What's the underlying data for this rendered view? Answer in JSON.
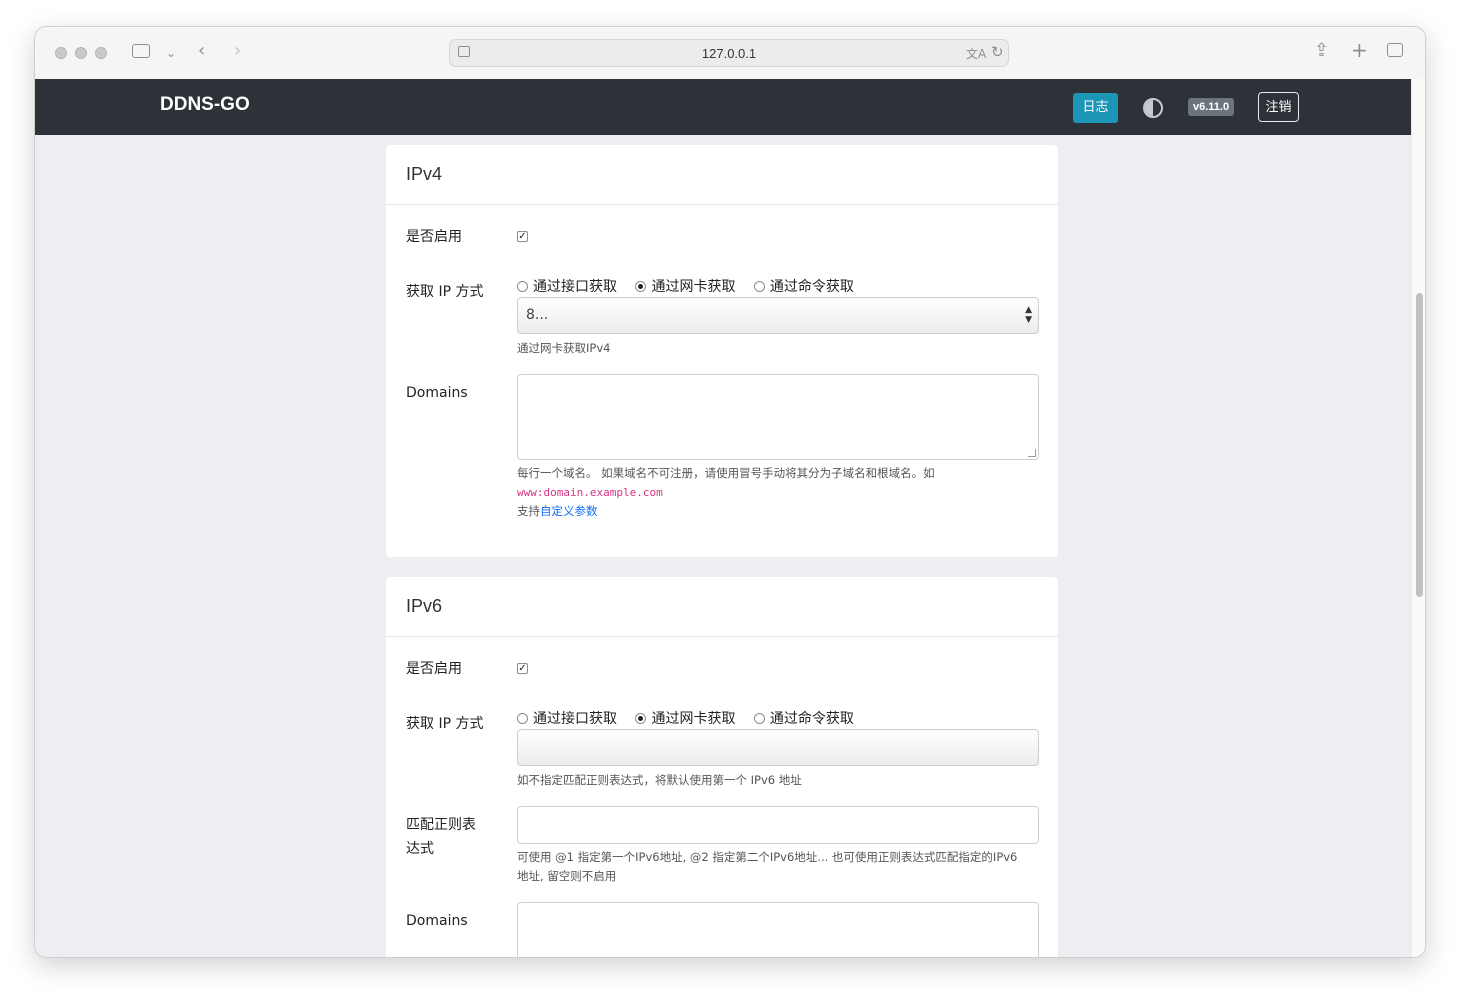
{
  "browser": {
    "url": "127.0.0.1"
  },
  "app": {
    "brand": "DDNS-GO",
    "log_button": "日志",
    "version": "v6.11.0",
    "logout_button": "注销"
  },
  "ipv4": {
    "title": "IPv4",
    "enable_label": "是否启用",
    "enabled": true,
    "method_label": "获取 IP 方式",
    "methods": [
      {
        "label": "通过接口获取",
        "checked": false
      },
      {
        "label": "通过网卡获取",
        "checked": true
      },
      {
        "label": "通过命令获取",
        "checked": false
      }
    ],
    "interface_value": "8...",
    "interface_help": "通过网卡获取IPv4",
    "domains_label": "Domains",
    "domains_value": "",
    "domains_help_1": "每行一个域名。 如果域名不可注册，请使用冒号手动将其分为子域名和根域名。如",
    "domains_help_example": "www:domain.example.com",
    "domains_help_support": "支持",
    "domains_help_link": "自定义参数"
  },
  "ipv6": {
    "title": "IPv6",
    "enable_label": "是否启用",
    "enabled": true,
    "method_label": "获取 IP 方式",
    "methods": [
      {
        "label": "通过接口获取",
        "checked": false
      },
      {
        "label": "通过网卡获取",
        "checked": true
      },
      {
        "label": "通过命令获取",
        "checked": false
      }
    ],
    "interface_value": "",
    "interface_help": "如不指定匹配正则表达式，将默认使用第一个 IPv6 地址",
    "regex_label": "匹配正则表达式",
    "regex_value": "",
    "regex_help": "可使用 @1 指定第一个IPv6地址, @2 指定第二个IPv6地址... 也可使用正则表达式匹配指定的IPv6地址, 留空则不启用",
    "domains_label": "Domains",
    "domains_value": ""
  }
}
